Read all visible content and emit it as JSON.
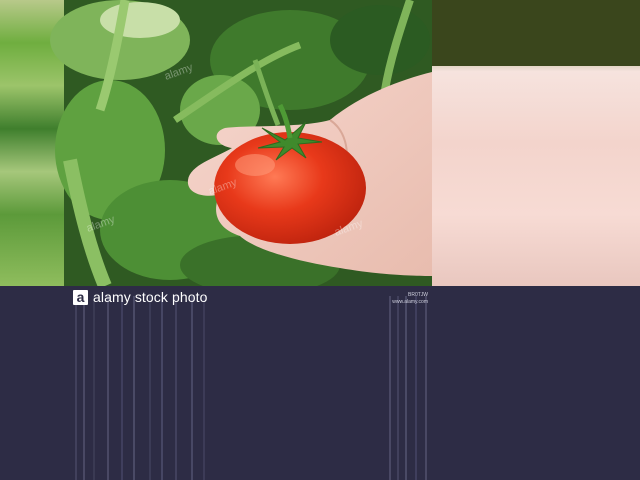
{
  "watermark": {
    "brand": "alamy stock photo",
    "logo_letter": "a",
    "overlay_text": "alamy",
    "image_id": "BR0TJW",
    "site": "www.alamy.com"
  },
  "colors": {
    "footer": "#2d2c45",
    "tomato": "#e23a1c",
    "leaf": "#4f9a3c",
    "skin": "#f3d0c6"
  }
}
